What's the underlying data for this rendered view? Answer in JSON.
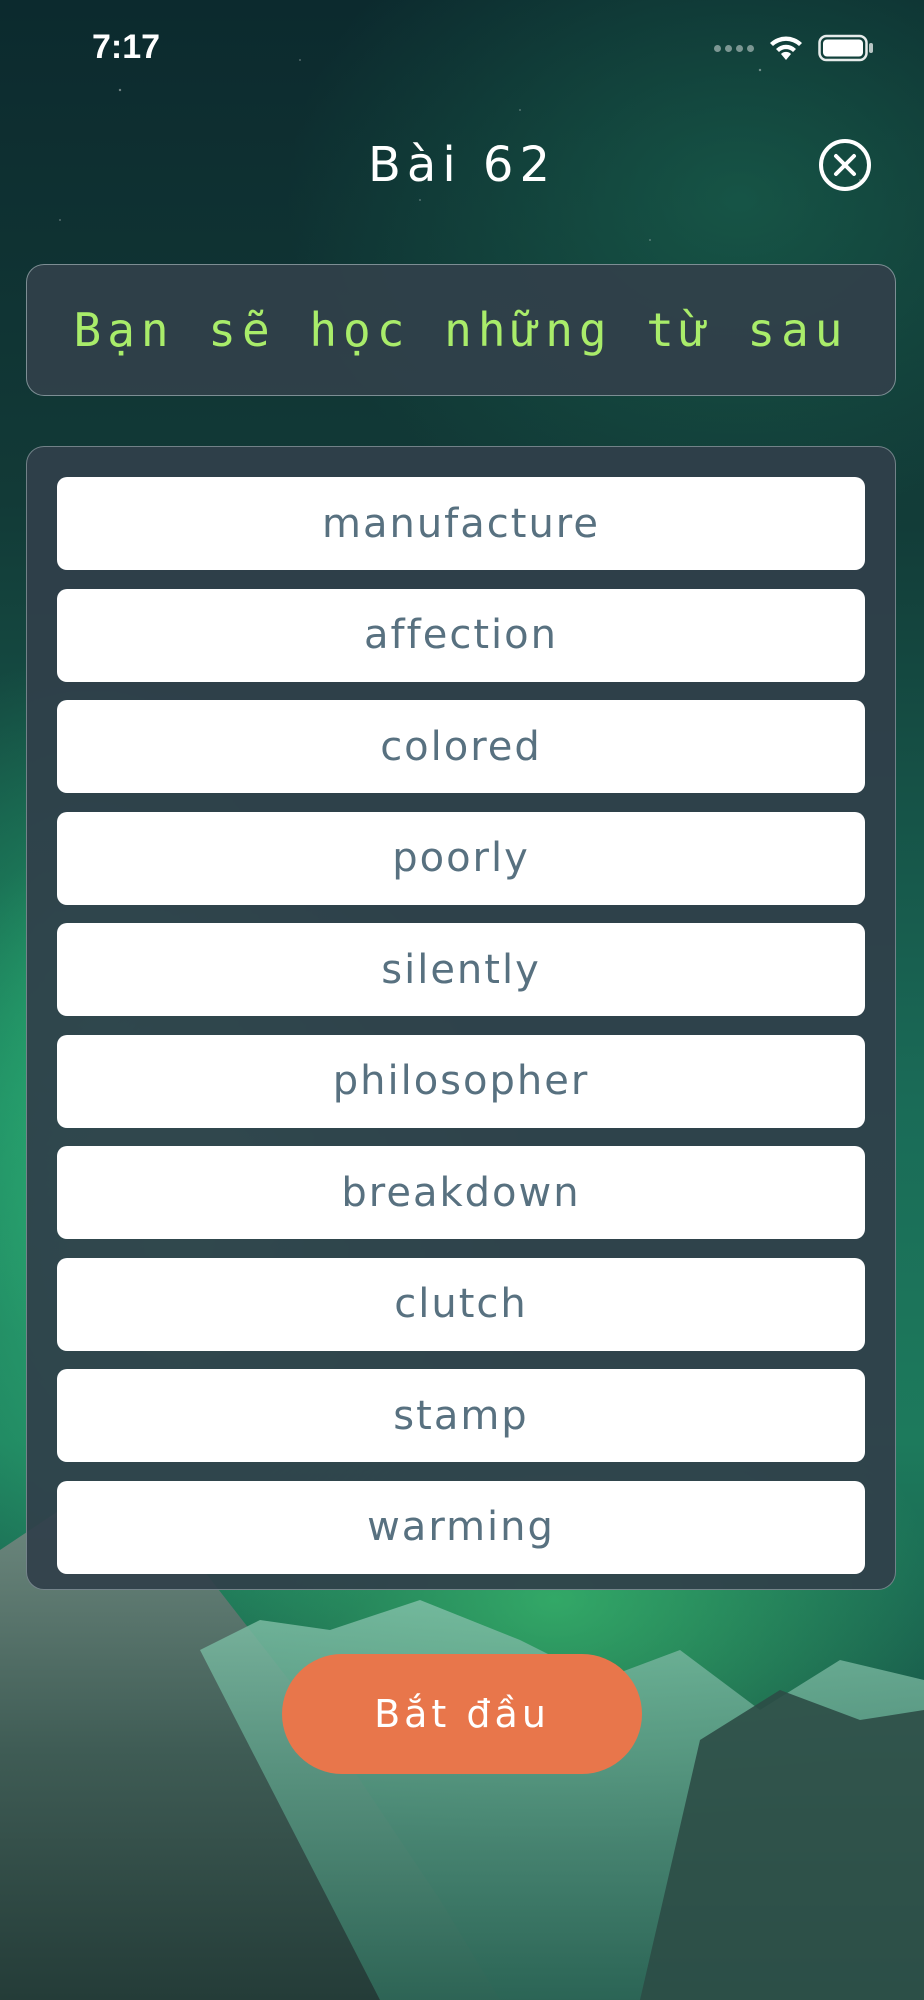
{
  "status_bar": {
    "time": "7:17",
    "icons": [
      "signal-dots-icon",
      "wifi-icon",
      "battery-icon"
    ]
  },
  "header": {
    "title": "Bài 62",
    "close_icon": "close-circle-icon"
  },
  "banner": {
    "text": "Bạn sẽ học những từ sau"
  },
  "words": [
    "manufacture",
    "affection",
    "colored",
    "poorly",
    "silently",
    "philosopher",
    "breakdown",
    "clutch",
    "stamp",
    "warming"
  ],
  "start_button": {
    "label": "Bắt đầu"
  },
  "colors": {
    "banner_text": "#a9ec6a",
    "word_text": "#587180",
    "start_button": "#e8764b",
    "panel_bg": "#30404a"
  }
}
